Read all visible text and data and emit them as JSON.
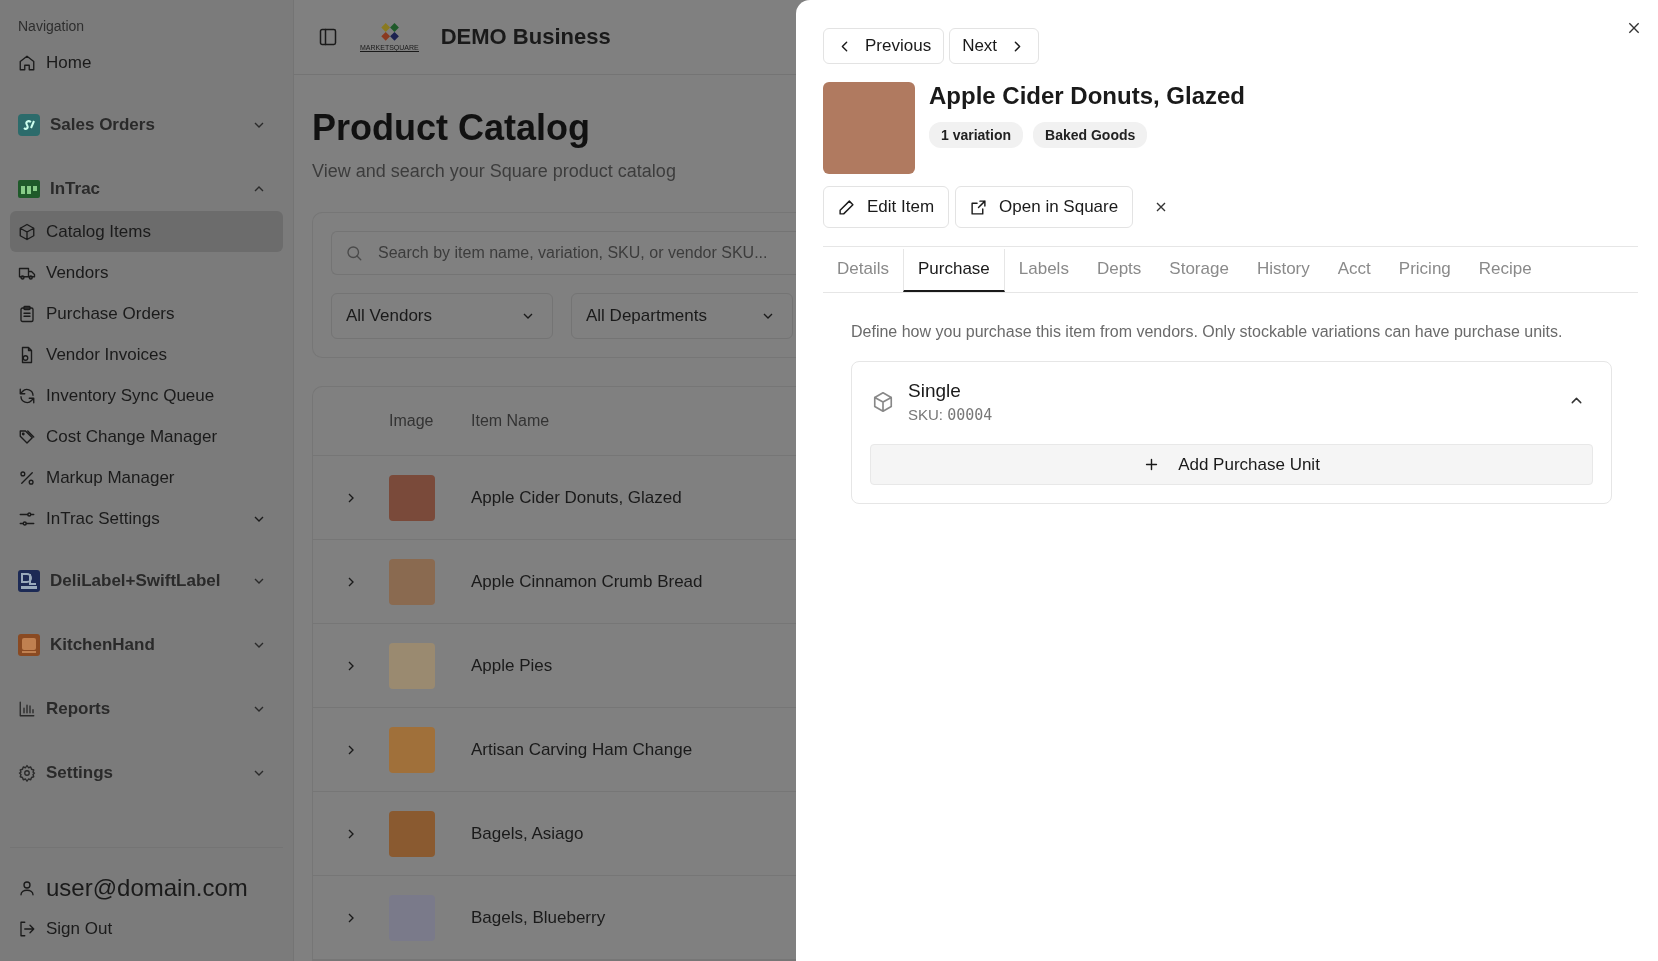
{
  "sidebar": {
    "heading": "Navigation",
    "items": [
      {
        "kind": "link",
        "label": "Home",
        "selected": false
      },
      {
        "kind": "group",
        "label": "Sales Orders",
        "expanded": false
      },
      {
        "kind": "group",
        "label": "InTrac",
        "expanded": true,
        "children": [
          {
            "kind": "link",
            "label": "Catalog Items",
            "selected": true
          },
          {
            "kind": "link",
            "label": "Vendors",
            "selected": false
          },
          {
            "kind": "link",
            "label": "Purchase Orders",
            "selected": false
          },
          {
            "kind": "link",
            "label": "Vendor Invoices",
            "selected": false
          },
          {
            "kind": "link",
            "label": "Inventory Sync Queue",
            "selected": false
          },
          {
            "kind": "link",
            "label": "Cost Change Manager",
            "selected": false
          },
          {
            "kind": "link",
            "label": "Markup Manager",
            "selected": false
          },
          {
            "kind": "subgroup",
            "label": "InTrac Settings",
            "expanded": false
          }
        ]
      },
      {
        "kind": "group",
        "label": "DeliLabel+SwiftLabel",
        "expanded": false
      },
      {
        "kind": "group",
        "label": "KitchenHand",
        "expanded": false
      },
      {
        "kind": "group",
        "label": "Reports",
        "expanded": false
      },
      {
        "kind": "group",
        "label": "Settings",
        "expanded": false
      }
    ],
    "user_email": "user@domain.com",
    "sign_out": "Sign Out"
  },
  "header": {
    "logo_text": "MARKETSQUARE",
    "business": "DEMO Business"
  },
  "page": {
    "title": "Product Catalog",
    "subtitle": "View and search your Square product catalog",
    "search": {
      "placeholder": "Search by item name, variation, SKU, or vendor SKU..."
    },
    "filters": [
      "All Vendors",
      "All Departments"
    ],
    "table": {
      "columns": [
        "Image",
        "Item Name"
      ],
      "rows": [
        {
          "name": "Apple Cider Donuts, Glazed"
        },
        {
          "name": "Apple Cinnamon Crumb Bread"
        },
        {
          "name": "Apple Pies"
        },
        {
          "name": "Artisan Carving Ham Change"
        },
        {
          "name": "Bagels, Asiago"
        },
        {
          "name": "Bagels, Blueberry"
        }
      ]
    }
  },
  "drawer": {
    "previous": "Previous",
    "next": "Next",
    "title": "Apple Cider Donuts, Glazed",
    "badges": [
      "1 variation",
      "Baked Goods"
    ],
    "actions": [
      "Edit Item",
      "Open in Square"
    ],
    "tabs": [
      {
        "label": "Details",
        "selected": false
      },
      {
        "label": "Purchase",
        "selected": true
      },
      {
        "label": "Labels",
        "selected": false
      },
      {
        "label": "Depts",
        "selected": false
      },
      {
        "label": "Storage",
        "selected": false
      },
      {
        "label": "History",
        "selected": false
      },
      {
        "label": "Acct",
        "selected": false
      },
      {
        "label": "Pricing",
        "selected": false
      },
      {
        "label": "Recipe",
        "selected": false
      }
    ],
    "description": "Define how you purchase this item from vendors. Only stockable variations can have purchase units.",
    "variation": {
      "name": "Single",
      "sku_label": "SKU:",
      "sku": "00004",
      "expanded": true
    },
    "add_button": "Add Purchase Unit"
  }
}
